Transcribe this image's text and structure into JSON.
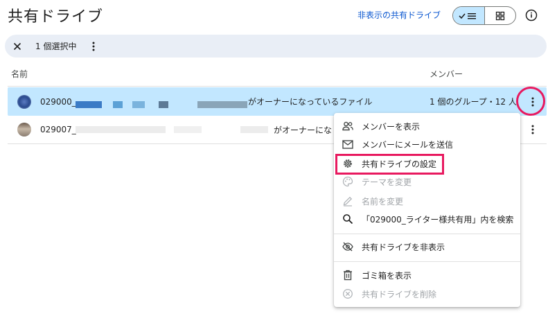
{
  "header": {
    "title": "共有ドライブ",
    "hidden_link": "非表示の共有ドライブ",
    "view_list_icon": "check-list-icon",
    "view_grid_icon": "grid-icon",
    "info_icon": "info-icon"
  },
  "selection_bar": {
    "close_icon": "close-icon",
    "count_label": "1 個選択中",
    "more_icon": "more-vert-icon"
  },
  "columns": {
    "name": "名前",
    "members": "メンバー"
  },
  "rows": [
    {
      "name": "029000_",
      "suffix": "がオーナーになっているファイル",
      "members": "1 個のグループ・12 人",
      "selected": true
    },
    {
      "name": "029007_",
      "suffix": "がオーナーにな",
      "members": "",
      "selected": false
    }
  ],
  "menu": {
    "items": [
      {
        "label": "メンバーを表示",
        "icon": "people-icon",
        "disabled": false
      },
      {
        "label": "メンバーにメールを送信",
        "icon": "mail-icon",
        "disabled": false
      },
      {
        "label": "共有ドライブの設定",
        "icon": "gear-icon",
        "disabled": false
      },
      {
        "label": "テーマを変更",
        "icon": "palette-icon",
        "disabled": true
      },
      {
        "label": "名前を変更",
        "icon": "pencil-icon",
        "disabled": true
      },
      {
        "label": "「029000_ライター様共有用」内を検索",
        "icon": "search-icon",
        "disabled": false
      },
      {
        "label": "共有ドライブを非表示",
        "icon": "eye-off-icon",
        "disabled": false
      },
      {
        "label": "ゴミ箱を表示",
        "icon": "trash-icon",
        "disabled": false
      },
      {
        "label": "共有ドライブを削除",
        "icon": "remove-circle-icon",
        "disabled": true
      }
    ]
  },
  "colors": {
    "accent": "#0b57d0",
    "selected_row": "#c2e7ff",
    "annotation": "#e8195f"
  }
}
